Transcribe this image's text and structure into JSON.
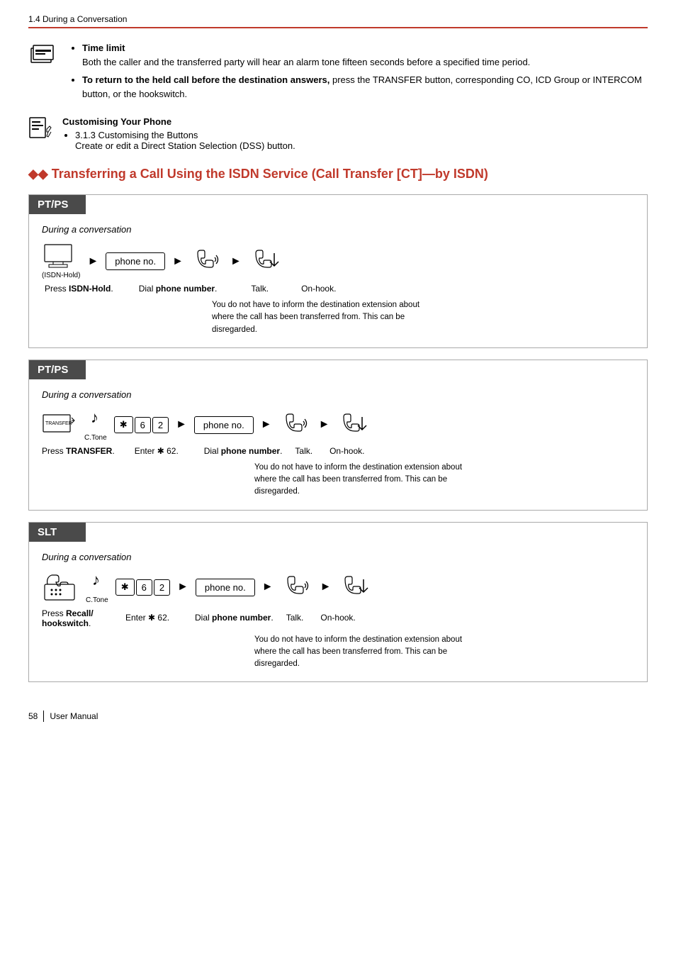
{
  "header": {
    "section": "1.4 During a Conversation"
  },
  "tips": [
    {
      "title": "Time limit",
      "text": "Both the caller and the transferred party will hear an alarm tone fifteen seconds before a specified time period."
    },
    {
      "text": "To return to the held call before the destination answers, press the TRANSFER button, corresponding CO, ICD Group or INTERCOM button, or the hookswitch.",
      "bold_start": "To return to the held call before the destination answers,"
    }
  ],
  "customise": {
    "title": "Customising Your Phone",
    "items": [
      "3.1.3 Customising the Buttons",
      "Create or edit a Direct Station Selection (DSS) button."
    ]
  },
  "main_title": "Transferring a Call Using the ISDN Service (Call Transfer [CT]—by ISDN)",
  "panels": [
    {
      "type": "PT/PS",
      "during": "During a conversation",
      "flow": [
        {
          "kind": "icon",
          "name": "isdn-hold-icon",
          "label": "(ISDN-Hold)"
        },
        {
          "kind": "arrow"
        },
        {
          "kind": "btnbox",
          "text": "phone no."
        },
        {
          "kind": "arrow"
        },
        {
          "kind": "icon",
          "name": "talk-icon"
        },
        {
          "kind": "arrow"
        },
        {
          "kind": "icon",
          "name": "onhook-icon"
        }
      ],
      "labels": [
        {
          "text": "Press ISDN-Hold.",
          "bold": "ISDN-Hold"
        },
        {
          "text": "Dial phone number.",
          "bold": "phone number"
        },
        {
          "text": "Talk."
        },
        {
          "text": "On-hook."
        }
      ],
      "note": "You do not have to inform the destination extension about where the call has been transferred from. This can be disregarded."
    },
    {
      "type": "PT/PS",
      "during": "During a conversation",
      "flow": [
        {
          "kind": "icon",
          "name": "transfer-icon",
          "label": "TRANSFER"
        },
        {
          "kind": "tone",
          "label": "C.Tone"
        },
        {
          "kind": "keyseq",
          "keys": [
            "✱",
            "6",
            "2"
          ]
        },
        {
          "kind": "arrow"
        },
        {
          "kind": "btnbox",
          "text": "phone no."
        },
        {
          "kind": "arrow"
        },
        {
          "kind": "icon",
          "name": "talk-icon"
        },
        {
          "kind": "arrow"
        },
        {
          "kind": "icon",
          "name": "onhook-icon"
        }
      ],
      "labels": [
        {
          "text": "Press TRANSFER.",
          "bold": "TRANSFER"
        },
        {
          "text": "Enter ✱ 62."
        },
        {
          "text": "Dial phone number.",
          "bold": "phone number"
        },
        {
          "text": "Talk."
        },
        {
          "text": "On-hook."
        }
      ],
      "note": "You do not have to inform the destination extension about where the call has been transferred from. This can be disregarded."
    },
    {
      "type": "SLT",
      "during": "During a conversation",
      "flow": [
        {
          "kind": "icon",
          "name": "recall-icon"
        },
        {
          "kind": "tone",
          "label": "C.Tone"
        },
        {
          "kind": "keyseq",
          "keys": [
            "✱",
            "6",
            "2"
          ]
        },
        {
          "kind": "arrow"
        },
        {
          "kind": "btnbox",
          "text": "phone no."
        },
        {
          "kind": "arrow"
        },
        {
          "kind": "icon",
          "name": "talk-icon"
        },
        {
          "kind": "arrow"
        },
        {
          "kind": "icon",
          "name": "onhook-icon"
        }
      ],
      "labels": [
        {
          "text": "Press Recall/ hookswitch.",
          "bold": "Recall/"
        },
        {
          "text": "Enter ✱ 62."
        },
        {
          "text": "Dial phone number.",
          "bold": "phone number"
        },
        {
          "text": "Talk."
        },
        {
          "text": "On-hook."
        }
      ],
      "note": "You do not have to inform the destination extension about where the call has been transferred from. This can be disregarded."
    }
  ],
  "footer": {
    "page": "58",
    "label": "User Manual"
  }
}
